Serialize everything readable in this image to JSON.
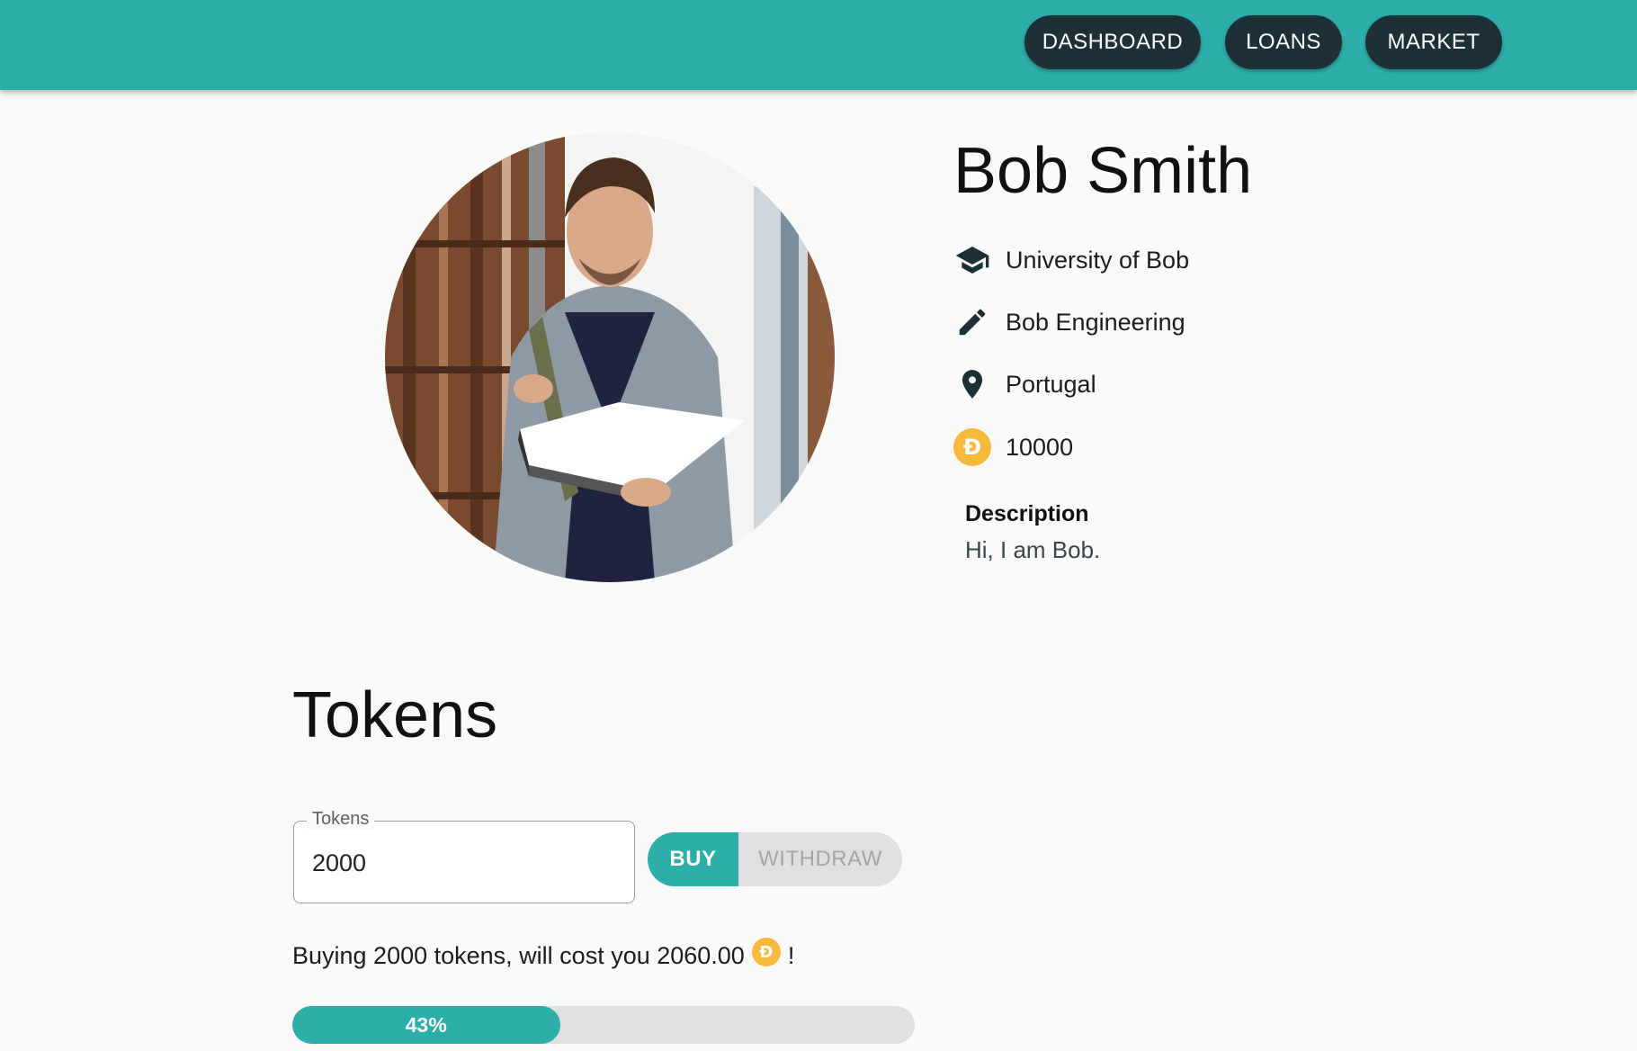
{
  "nav": {
    "dashboard": "DASHBOARD",
    "loans": "LOANS",
    "market": "MARKET"
  },
  "profile": {
    "name": "Bob Smith",
    "university": "University of Bob",
    "course": "Bob Engineering",
    "location": "Portugal",
    "balance": "10000",
    "description_title": "Description",
    "description": "Hi, I am Bob."
  },
  "tokens": {
    "title": "Tokens",
    "field_label": "Tokens",
    "field_value": "2000",
    "buy_label": "BUY",
    "withdraw_label": "WITHDRAW",
    "cost_text": "Buying 2000 tokens, will cost you 2060.00",
    "cost_suffix": "!",
    "progress_label": "43%",
    "progress_value": 43
  },
  "icons": {
    "university": "graduation-cap-icon",
    "course": "pencil-icon",
    "location": "location-pin-icon",
    "balance": "coin-icon"
  },
  "colors": {
    "primary": "#2eaeaa",
    "nav_button": "#1f2f36",
    "coin": "#f6b93b"
  }
}
